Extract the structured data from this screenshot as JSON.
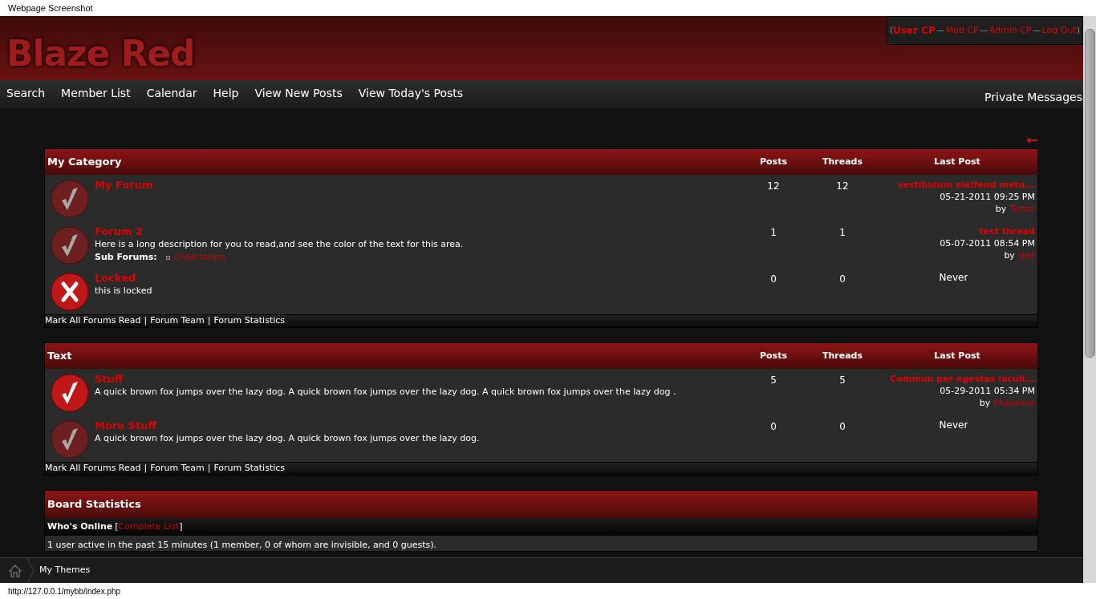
{
  "window": {
    "title": "Webpage Screenshot"
  },
  "header": {
    "logo": "Blaze Red",
    "user_links": [
      {
        "label": "User CP",
        "bold": true
      },
      {
        "label": "Mod CP",
        "bold": false
      },
      {
        "label": "Admin CP",
        "bold": false
      },
      {
        "label": "Log Out",
        "bold": false
      }
    ],
    "open_paren": "(",
    "close_paren": ")",
    "separator": "—"
  },
  "nav": {
    "items": [
      "Search",
      "Member List",
      "Calendar",
      "Help",
      "View New Posts",
      "View Today's Posts"
    ],
    "right": "Private Messages"
  },
  "categories": [
    {
      "title": "My Category",
      "columns": [
        "Posts",
        "Threads",
        "Last Post"
      ],
      "forums": [
        {
          "kind": "old",
          "name": "My Forum",
          "posts": "12",
          "threads": "12",
          "last_post": {
            "thread": "vestibulum eleifend metu...",
            "date": "05-21-2011 09:25 PM",
            "by": "by",
            "author": "Tortor"
          }
        },
        {
          "kind": "old",
          "name": "Forum 2",
          "description": "Here is a long description for you to read,and see the color of the text for this area.",
          "subforums_label": "Sub Forums:",
          "subforums": [
            "Child forum"
          ],
          "posts": "1",
          "threads": "1",
          "last_post": {
            "thread": "test thread",
            "date": "05-07-2011 08:54 PM",
            "by": "by",
            "author": "test"
          }
        },
        {
          "kind": "locked",
          "name": "Locked",
          "description": "this is locked",
          "posts": "0",
          "threads": "0",
          "never": "Never"
        }
      ],
      "footer_links": [
        "Mark All Forums Read",
        "Forum Team",
        "Forum Statistics"
      ],
      "footer_sep": "|"
    },
    {
      "title": "Text",
      "columns": [
        "Posts",
        "Threads",
        "Last Post"
      ],
      "forums": [
        {
          "kind": "new",
          "name": "Stuff",
          "description": "A quick brown fox jumps over the lazy dog. A quick brown fox jumps over the lazy dog. A quick brown fox jumps over the lazy dog .",
          "posts": "5",
          "threads": "5",
          "last_post": {
            "thread": "Commun per egestas iaculi...",
            "date": "05-29-2011 05:34 PM",
            "by": "by",
            "author": "Phasellus"
          }
        },
        {
          "kind": "old",
          "name": "More Stuff",
          "description": "A quick brown fox jumps over the lazy dog. A quick brown fox jumps over the lazy dog.",
          "posts": "0",
          "threads": "0",
          "never": "Never"
        }
      ],
      "footer_links": [
        "Mark All Forums Read",
        "Forum Team",
        "Forum Statistics"
      ],
      "footer_sep": "|"
    }
  ],
  "board_stats": {
    "title": "Board Statistics",
    "whos_online": "Who's Online",
    "bracket_open": "[",
    "complete_list": "Complete List",
    "bracket_close": "]",
    "active_text": "1 user active in the past 15 minutes (1 member, 0 of whom are invisible, and 0 guests)."
  },
  "bottom_bar": {
    "label": "My Themes"
  },
  "status_bar": {
    "url": "http://127.0.0.1/mybb/index.php"
  }
}
